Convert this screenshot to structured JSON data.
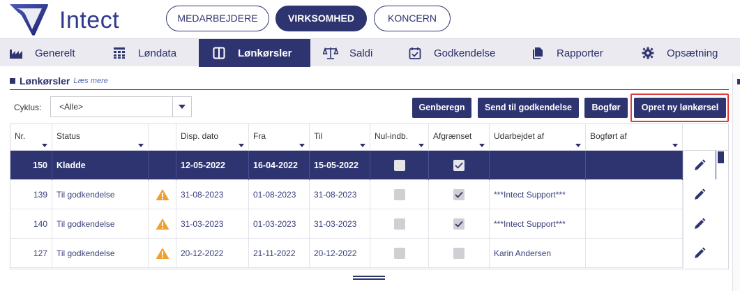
{
  "header": {
    "logo_text": "Intect",
    "tabs": [
      {
        "label": "MEDARBEJDERE",
        "active": false
      },
      {
        "label": "VIRKSOMHED",
        "active": true
      },
      {
        "label": "KONCERN",
        "active": false
      }
    ]
  },
  "nav": {
    "items": [
      {
        "label": "Generelt",
        "icon": "factory-icon",
        "active": false
      },
      {
        "label": "Løndata",
        "icon": "grid-table-icon",
        "active": false
      },
      {
        "label": "Lønkørsler",
        "icon": "columns-icon",
        "active": true
      },
      {
        "label": "Saldi",
        "icon": "scales-icon",
        "active": false
      },
      {
        "label": "Godkendelse",
        "icon": "calendar-check-icon",
        "active": false
      },
      {
        "label": "Rapporter",
        "icon": "documents-icon",
        "active": false
      },
      {
        "label": "Opsætning",
        "icon": "gear-icon",
        "active": false
      }
    ]
  },
  "section": {
    "title": "Lønkørsler",
    "more_link": "Læs mere"
  },
  "toolbar": {
    "cycle_label": "Cyklus:",
    "cycle_value": "<Alle>",
    "buttons": {
      "recalculate": "Genberegn",
      "send_for_approval": "Send til godkendelse",
      "post": "Bogfør",
      "create_new": "Opret ny lønkørsel"
    }
  },
  "table": {
    "columns": [
      "Nr.",
      "Status",
      "",
      "Disp. dato",
      "Fra",
      "Til",
      "Nul-indb.",
      "Afgrænset",
      "Udarbejdet af",
      "Bogført af",
      ""
    ],
    "rows": [
      {
        "nr": "150",
        "status": "Kladde",
        "warning": false,
        "disp": "12-05-2022",
        "fra": "16-04-2022",
        "til": "15-05-2022",
        "nul": false,
        "afgr": true,
        "udarbejdet": "",
        "bogfort": "",
        "selected": true
      },
      {
        "nr": "139",
        "status": "Til godkendelse",
        "warning": true,
        "disp": "31-08-2023",
        "fra": "01-08-2023",
        "til": "31-08-2023",
        "nul": false,
        "afgr": true,
        "udarbejdet": "***Intect Support***",
        "bogfort": "",
        "selected": false
      },
      {
        "nr": "140",
        "status": "Til godkendelse",
        "warning": true,
        "disp": "31-03-2023",
        "fra": "01-03-2023",
        "til": "31-03-2023",
        "nul": false,
        "afgr": true,
        "udarbejdet": "***Intect Support***",
        "bogfort": "",
        "selected": false
      },
      {
        "nr": "127",
        "status": "Til godkendelse",
        "warning": true,
        "disp": "20-12-2022",
        "fra": "21-11-2022",
        "til": "20-12-2022",
        "nul": false,
        "afgr": false,
        "udarbejdet": "Karin Andersen",
        "bogfort": "",
        "selected": false
      }
    ]
  },
  "colors": {
    "primary": "#2e3470",
    "highlight": "#e03a3a",
    "warning": "#f0a030"
  }
}
